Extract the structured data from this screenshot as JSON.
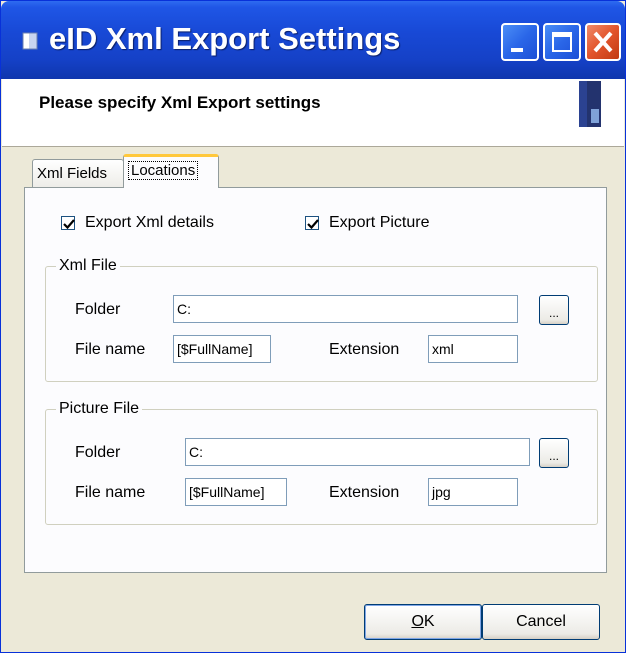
{
  "window": {
    "title": "eID Xml Export Settings"
  },
  "header": {
    "text": "Please specify Xml Export settings"
  },
  "tabs": [
    {
      "label": "Xml Fields"
    },
    {
      "label": "Locations"
    }
  ],
  "options": {
    "export_xml_details": {
      "label": "Export Xml details",
      "checked": true
    },
    "export_picture": {
      "label": "Export Picture",
      "checked": true
    }
  },
  "xml_file": {
    "group_title": "Xml File",
    "folder_label": "Folder",
    "folder_value": "C:",
    "browse_label": "...",
    "filename_label": "File name",
    "filename_value": "[$FullName]",
    "extension_label": "Extension",
    "extension_value": "xml"
  },
  "picture_file": {
    "group_title": "Picture File",
    "folder_label": "Folder",
    "folder_value": "C:",
    "browse_label": "...",
    "filename_label": "File name",
    "filename_value": "[$FullName]",
    "extension_label": "Extension",
    "extension_value": "jpg"
  },
  "buttons": {
    "ok_mnemonic": "O",
    "ok_rest": "K",
    "cancel": "Cancel"
  },
  "colors": {
    "titlebar": "#1849d6",
    "window_bg": "#ece9d8",
    "close_button": "#e2542b"
  }
}
